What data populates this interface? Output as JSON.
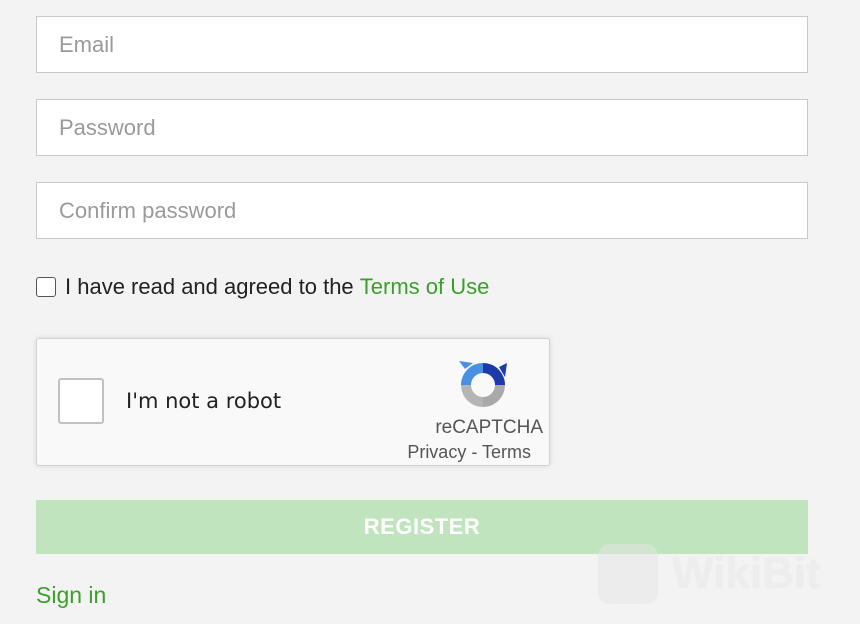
{
  "form": {
    "email": {
      "placeholder": "Email",
      "value": ""
    },
    "password": {
      "placeholder": "Password",
      "value": ""
    },
    "confirm_password": {
      "placeholder": "Confirm password",
      "value": ""
    },
    "terms": {
      "checked": false,
      "text": "I have read and agreed to the ",
      "link_label": "Terms of Use"
    },
    "recaptcha": {
      "label": "I'm not a robot",
      "brand": "reCAPTCHA",
      "privacy_label": "Privacy",
      "separator": " - ",
      "terms_label": "Terms",
      "logo_icon": "recaptcha-logo-icon"
    },
    "register_label": "REGISTER",
    "signin_label": "Sign in"
  },
  "watermark": {
    "text": "WikiBit"
  },
  "colors": {
    "link_green": "#3aa02a",
    "register_bg": "#c0e4bd",
    "page_bg": "#f3f3f3"
  }
}
